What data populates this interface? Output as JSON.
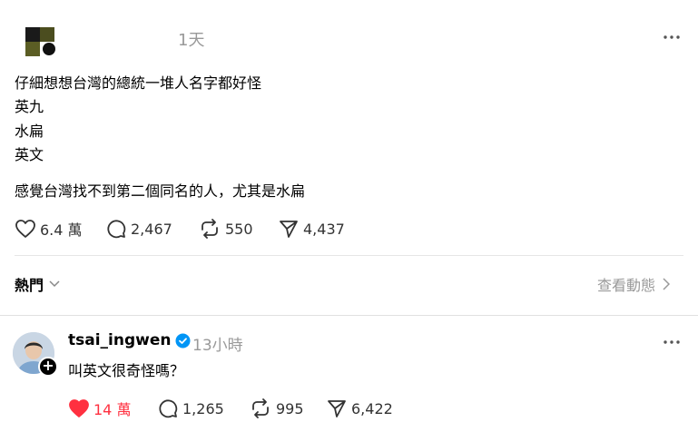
{
  "post": {
    "time": "1天",
    "lines": [
      "仔細想想台灣的總統一堆人名字都好怪",
      "英九",
      "水扁",
      "英文",
      "感覺台灣找不到第二個同名的人，尤其是水扁"
    ],
    "likes": "6.4 萬",
    "replies": "2,467",
    "reposts": "550",
    "shares": "4,437"
  },
  "sort": {
    "label": "熱門",
    "view_activity": "查看動態"
  },
  "reply": {
    "username": "tsai_ingwen",
    "time": "13小時",
    "text": "叫英文很奇怪嗎？",
    "likes": "14 萬",
    "replies": "1,265",
    "reposts": "995",
    "shares": "6,422",
    "liked_color": "#ff3040",
    "verified_color": "#0095f6"
  },
  "icons": [
    "heart-icon",
    "comment-icon",
    "repost-icon",
    "share-icon",
    "more-icon",
    "chevron-down-icon",
    "chevron-right-icon",
    "verified-badge-icon",
    "follow-plus-icon"
  ]
}
